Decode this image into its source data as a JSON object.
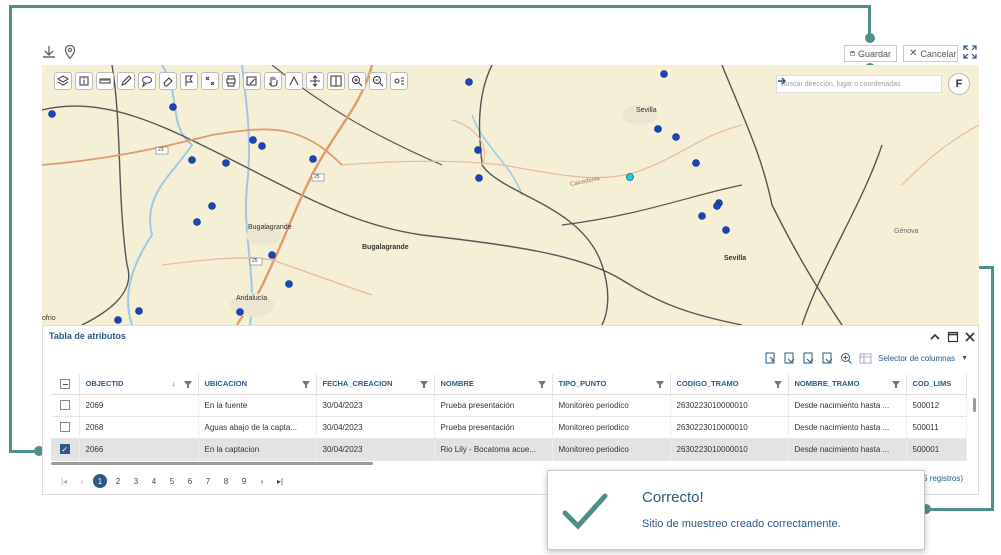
{
  "header": {
    "save_label": "Guardar",
    "cancel_label": "Cancelar"
  },
  "map": {
    "search_placeholder": "Buscar dirección, lugar o coordenadas",
    "f_button": "F",
    "labels": {
      "bugalagrande_town": "Bugalagrande",
      "bugalagrande_region": "Bugalagrande",
      "sevilla_town": "Sevilla",
      "sevilla_region": "Sevilla",
      "andalucia": "Andalucía",
      "genova": "Génova",
      "caicedonia": "Caicedonia",
      "ofrio": "ofrio",
      "road_23": "23",
      "road_25a": "25",
      "road_25b": "25"
    }
  },
  "attributes": {
    "title": "Tabla de atributos",
    "column_selector": "Selector de columnas",
    "columns": [
      "OBJECTID",
      "UBICACION",
      "FECHA_CREACION",
      "NOMBRE",
      "TIPO_PUNTO",
      "CODIGO_TRAMO",
      "NOMBRE_TRAMO",
      "COD_LIMS"
    ],
    "rows": [
      {
        "objectid": "2069",
        "ubicacion": "En la fuente",
        "fecha": "30/04/2023",
        "nombre": "Prueba presentación",
        "tipo": "Monitoreo periodico",
        "codigo": "2630223010000010",
        "tramo": "Desde nacimiento hasta ...",
        "lims": "500012",
        "checked": false
      },
      {
        "objectid": "2068",
        "ubicacion": "Aguas abajo de la capta...",
        "fecha": "30/04/2023",
        "nombre": "Prueba presentación",
        "tipo": "Monitoreo periodico",
        "codigo": "2630223010000010",
        "tramo": "Desde nacimiento hasta ...",
        "lims": "500011",
        "checked": false
      },
      {
        "objectid": "2066",
        "ubicacion": "En la captacion",
        "fecha": "30/04/2023",
        "nombre": "Rio Lily - Bocatoma acue...",
        "tipo": "Monitoreo periodico",
        "codigo": "2630223010000010",
        "tramo": "Desde nacimiento hasta ...",
        "lims": "500001",
        "checked": true
      }
    ],
    "pages": [
      "1",
      "2",
      "3",
      "4",
      "5",
      "6",
      "7",
      "8",
      "9"
    ],
    "registros_tail": "5 registros)"
  },
  "toast": {
    "title": "Correcto!",
    "message": "Sitio de muestreo creado correctamente."
  },
  "colors": {
    "accent": "#4f8f8b",
    "primary": "#2a5a86",
    "map_bg": "#f5efd6",
    "point": "#1a44b8"
  }
}
